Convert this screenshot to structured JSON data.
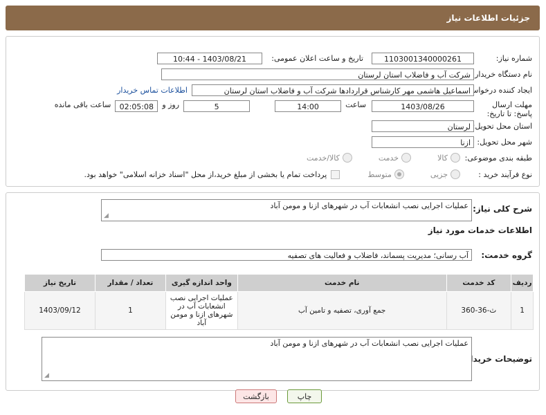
{
  "header": {
    "title": "جزئیات اطلاعات نیاز"
  },
  "form": {
    "need_number_label": "شماره نیاز:",
    "need_number": "1103001340000261",
    "announce_label": "تاریخ و ساعت اعلان عمومی:",
    "announce_value": "1403/08/21 - 10:44",
    "buyer_org_label": "نام دستگاه خریدار:",
    "buyer_org": "شرکت آب و فاضلاب استان لرستان",
    "creator_label": "ایجاد کننده درخواست:",
    "creator": "اسماعیل هاشمی مهر کارشناس قراردادها شرکت آب و فاضلاب استان لرستان",
    "contact_link": "اطلاعات تماس خریدار",
    "deadline_label": "مهلت ارسال پاسخ: تا تاریخ:",
    "deadline_date": "1403/08/26",
    "time_label": "ساعت",
    "deadline_time": "14:00",
    "days_value": "5",
    "days_label": "روز و",
    "remaining_time": "02:05:08",
    "remaining_label": "ساعت باقی مانده",
    "province_label": "استان محل تحویل:",
    "province": "لرستان",
    "city_label": "شهر محل تحویل:",
    "city": "ازنا",
    "category_label": "طبقه بندی موضوعی:",
    "category_options": [
      "کالا",
      "خدمت",
      "کالا/خدمت"
    ],
    "process_label": "نوع فرآیند خرید :",
    "process_options": [
      "جزیی",
      "متوسط"
    ],
    "payment_note": "پرداخت تمام یا بخشی از مبلغ خرید،از محل \"اسناد خزانه اسلامی\" خواهد بود."
  },
  "summary": {
    "label": "شرح کلی نیاز:",
    "value": "عملیات اجرایی نصب انشعابات آب در شهرهای ازنا و مومن آباد",
    "services_title": "اطلاعات خدمات مورد نیاز",
    "group_label": "گروه خدمت:",
    "group_value": "آب رسانی؛ مدیریت پسماند، فاضلاب و فعالیت های تصفیه"
  },
  "table": {
    "headers": [
      "ردیف",
      "کد خدمت",
      "نام خدمت",
      "واحد اندازه گیری",
      "تعداد / مقدار",
      "تاریخ نیاز"
    ],
    "rows": [
      [
        "1",
        "ث-36-360",
        "جمع آوری، تصفیه و تامین آب",
        "عملیات اجرایی نصب انشعابات آب در شهرهای ازنا و مومن آباد",
        "1",
        "1403/09/12"
      ]
    ]
  },
  "buyer_notes": {
    "label": "توضیحات خریدار:",
    "value": "عملیات اجرایی نصب انشعابات آب در شهرهای ازنا و مومن آباد"
  },
  "buttons": {
    "print": "چاپ",
    "back": "بازگشت"
  }
}
